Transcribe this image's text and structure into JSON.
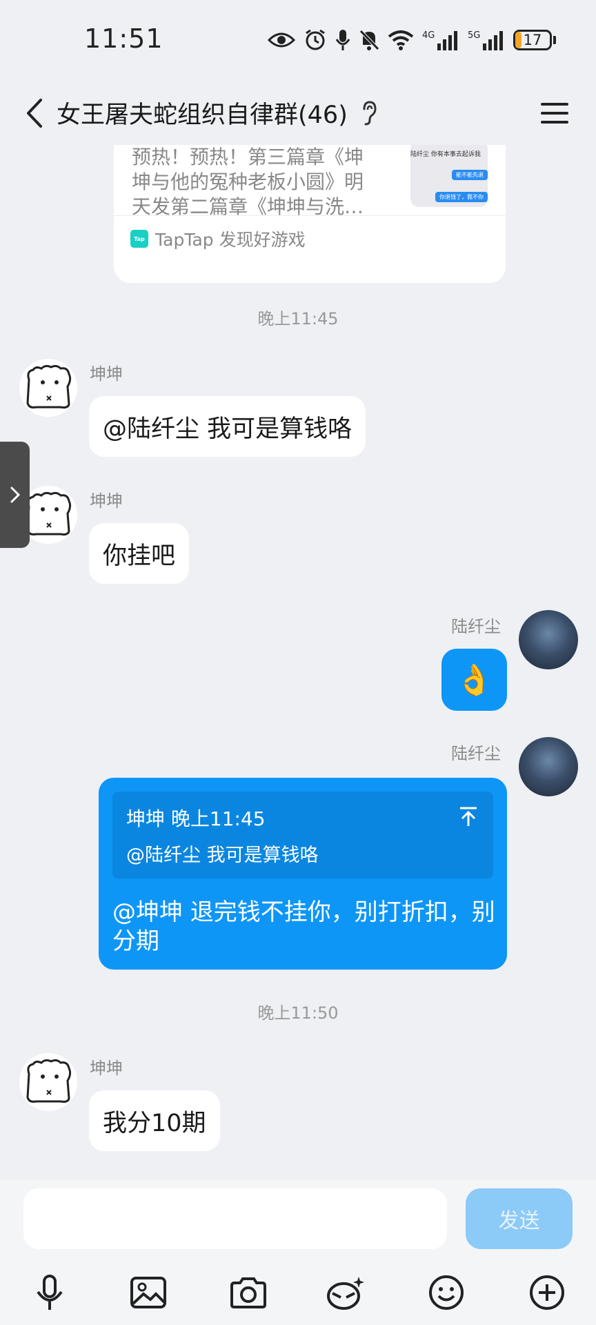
{
  "status_bar": {
    "time": "11:51",
    "network_1": "4G",
    "network_2": "5G",
    "battery_level": "17",
    "battery_fraction": 0.17,
    "icons": [
      "eye-icon",
      "alarm-icon",
      "mic-icon",
      "mute-bell-icon",
      "wifi-icon",
      "signal-4g-icon",
      "signal-5g-icon",
      "battery-icon"
    ]
  },
  "header": {
    "title": "女王屠夫蛇组织自律群(46)",
    "back_icon": "chevron-left-icon",
    "ear_icon": "ear-icon",
    "menu_icon": "hamburger-menu-icon"
  },
  "shared_card": {
    "text": "预热！预热！第三篇章《坤坤与他的冤种老板小圆》明天发第二篇章《坤坤与洗…",
    "thumb_line": "陆纤尘 你有本事去起诉我",
    "thumb_bubble_1": "能不能先退",
    "thumb_bubble_2": "你退钱了，我不你",
    "footer_logo": "Tap",
    "footer": "TapTap 发现好游戏"
  },
  "messages": [
    {
      "type": "time",
      "text": "晚上11:45"
    },
    {
      "side": "left",
      "sender": "坤坤",
      "text": "@陆纤尘 我可是算钱咯"
    },
    {
      "side": "left",
      "sender": "坤坤",
      "text": "你挂吧"
    },
    {
      "side": "right",
      "sender": "陆纤尘",
      "emoji": "👌"
    },
    {
      "side": "right",
      "sender": "陆纤尘",
      "quote_header": "坤坤 晚上11:45",
      "quote_text": "@陆纤尘 我可是算钱咯",
      "text": "@坤坤 退完钱不挂你，别打折扣，别分期"
    },
    {
      "type": "time",
      "text": "晚上11:50"
    },
    {
      "side": "left",
      "sender": "坤坤",
      "text": "我分10期"
    }
  ],
  "input": {
    "placeholder": "",
    "value": "",
    "send_label": "发送"
  },
  "toolbar": {
    "icons": [
      "microphone-icon",
      "image-icon",
      "camera-icon",
      "red-packet-icon",
      "emoji-icon",
      "plus-icon"
    ]
  },
  "colors": {
    "background": "#eef0f4",
    "bubble_self": "#0e96f7",
    "bubble_other": "#ffffff",
    "send_disabled": "#8ccaf7",
    "taptap": "#19d0c4",
    "battery_fill": "#f3a52a"
  }
}
